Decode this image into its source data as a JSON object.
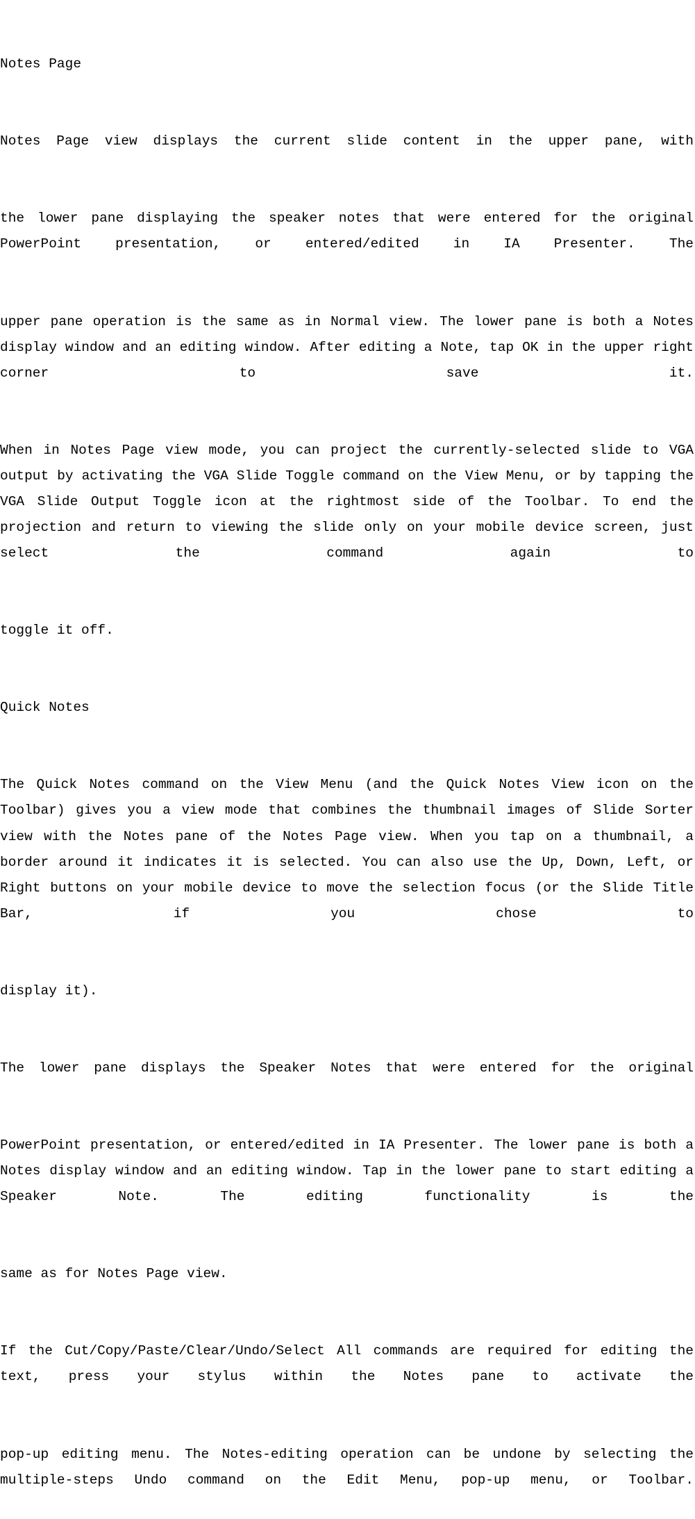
{
  "doc": {
    "lines": [
      "Notes Page",
      "Notes Page view displays the current slide content in the upper pane, with",
      "the lower pane displaying the speaker notes that were entered for the original PowerPoint presentation, or entered/edited in IA Presenter. The",
      "upper pane operation is the same as in Normal view. The lower pane is both a Notes display window and an editing window. After editing a Note, tap OK in the upper right corner to save it.",
      "When in Notes Page view mode, you can project the currently-selected slide to VGA output by activating the VGA Slide Toggle command on the View Menu, or by tapping the VGA Slide Output Toggle icon at the rightmost side of the Toolbar. To end the projection and return to viewing the slide only on your mobile device screen, just select the command again to",
      "toggle it off.",
      "Quick Notes",
      "The Quick Notes command on the View Menu (and the Quick Notes View icon on the Toolbar) gives you a view mode that combines the thumbnail images of Slide Sorter view with the Notes pane of the Notes Page view. When you tap on a thumbnail, a border around it indicates it is selected. You can also use the Up, Down, Left, or Right buttons on your mobile device to move the selection focus (or the Slide Title Bar, if you chose to",
      "display it).",
      "The lower pane displays the Speaker Notes that were entered for the original",
      "PowerPoint presentation, or entered/edited in IA Presenter. The lower pane is both a Notes display window and an editing window. Tap in the lower pane to start editing a Speaker Note. The editing functionality is the",
      "same as for Notes Page view.",
      "If the Cut/Copy/Paste/Clear/Undo/Select All commands are required for editing the text, press your stylus within the Notes pane to activate the",
      "pop-up editing menu. The Notes-editing operation can be undone by selecting the multiple-steps Undo command on the Edit Menu, pop-up menu, or Toolbar."
    ]
  }
}
